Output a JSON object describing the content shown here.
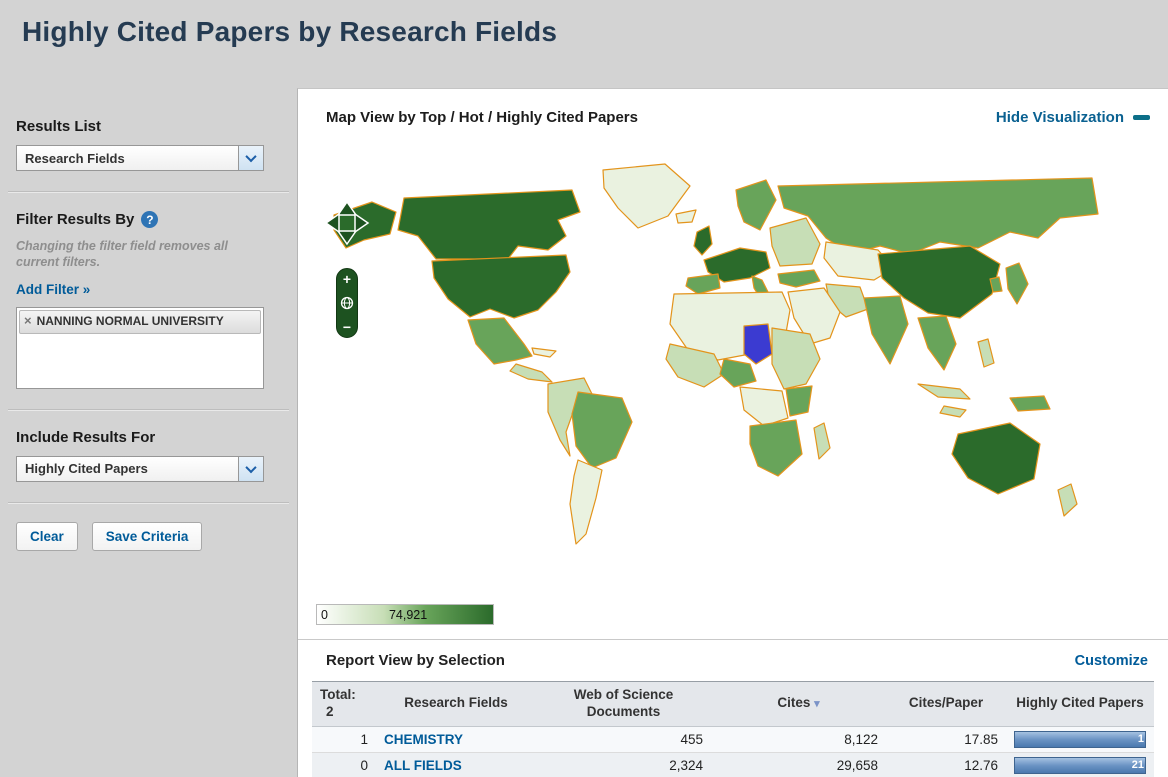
{
  "page": {
    "title": "Highly Cited Papers by Research Fields"
  },
  "sidebar": {
    "results_list_label": "Results List",
    "results_list_value": "Research Fields",
    "filter_label": "Filter Results By",
    "help_glyph": "?",
    "filter_note": "Changing the filter field removes all current filters.",
    "add_filter_label": "Add Filter »",
    "filter_tag": {
      "remove_glyph": "×",
      "label": "NANNING NORMAL UNIVERSITY"
    },
    "include_label": "Include Results For",
    "include_value": "Highly Cited Papers",
    "clear_button": "Clear",
    "save_button": "Save Criteria"
  },
  "map_section": {
    "title": "Map View by Top / Hot / Highly Cited Papers",
    "hide_link": "Hide Visualization",
    "legend_min": "0",
    "legend_max": "74,921",
    "palette": {
      "palest": "#eaf2e0",
      "light": "#c7deb6",
      "medium": "#68a45a",
      "dark": "#2b6b2b",
      "selected": "#3b3bd1",
      "border": "#e3941c"
    }
  },
  "report_section": {
    "title": "Report View by Selection",
    "customize_link": "Customize",
    "table": {
      "total_label": "Total:",
      "total_value": "2",
      "col_research_fields": "Research Fields",
      "col_documents": "Web of Science Documents",
      "col_cites": "Cites",
      "sort_desc_glyph": "▾",
      "col_cites_per_paper": "Cites/Paper",
      "col_highly_cited": "Highly Cited Papers",
      "rows": [
        {
          "rank": "1",
          "field": "CHEMISTRY",
          "documents": "455",
          "cites": "8,122",
          "cites_per_paper": "17.85",
          "highly_cited": "1"
        },
        {
          "rank": "0",
          "field": "ALL FIELDS",
          "documents": "2,324",
          "cites": "29,658",
          "cites_per_paper": "12.76",
          "highly_cited": "21"
        }
      ]
    }
  },
  "chart_data": [
    {
      "type": "heatmap",
      "title": "Map View by Top / Hot / Highly Cited Papers",
      "legend_range": [
        0,
        74921
      ],
      "description": "World choropleth shaded light-to-dark green by highly cited papers; one central-African country highlighted blue"
    },
    {
      "type": "table",
      "title": "Report View by Selection",
      "columns": [
        "Research Fields",
        "Web of Science Documents",
        "Cites",
        "Cites/Paper",
        "Highly Cited Papers"
      ],
      "rows": [
        [
          "CHEMISTRY",
          455,
          8122,
          17.85,
          1
        ],
        [
          "ALL FIELDS",
          2324,
          29658,
          12.76,
          21
        ]
      ]
    }
  ]
}
